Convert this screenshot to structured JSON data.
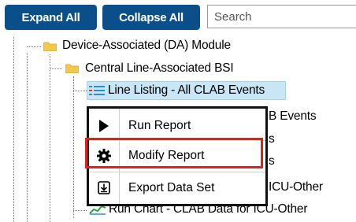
{
  "toolbar": {
    "expand_label": "Expand All",
    "collapse_label": "Collapse All",
    "search_placeholder": "Search"
  },
  "tree": {
    "module": "Device-Associated (DA) Module",
    "category": "Central Line-Associated BSI",
    "selected_item": "Line Listing - All CLAB Events",
    "hidden_item_tail_1": "B Events",
    "hidden_item_tail_2": "s",
    "hidden_item_tail_3": "s",
    "hidden_item_tail_4": "ICU-Other",
    "last_item": "Run Chart - CLAB Data for ICU-Other"
  },
  "context_menu": {
    "items": [
      {
        "label": "Run Report",
        "icon": "play-icon"
      },
      {
        "label": "Modify Report",
        "icon": "gear-icon"
      },
      {
        "label": "Export Data Set",
        "icon": "export-icon"
      }
    ]
  },
  "colors": {
    "button_bg": "#0b4f8a",
    "highlight_bg": "#c8e6f5",
    "focus_outline": "#e0201d",
    "folder": "#f2c94c"
  }
}
